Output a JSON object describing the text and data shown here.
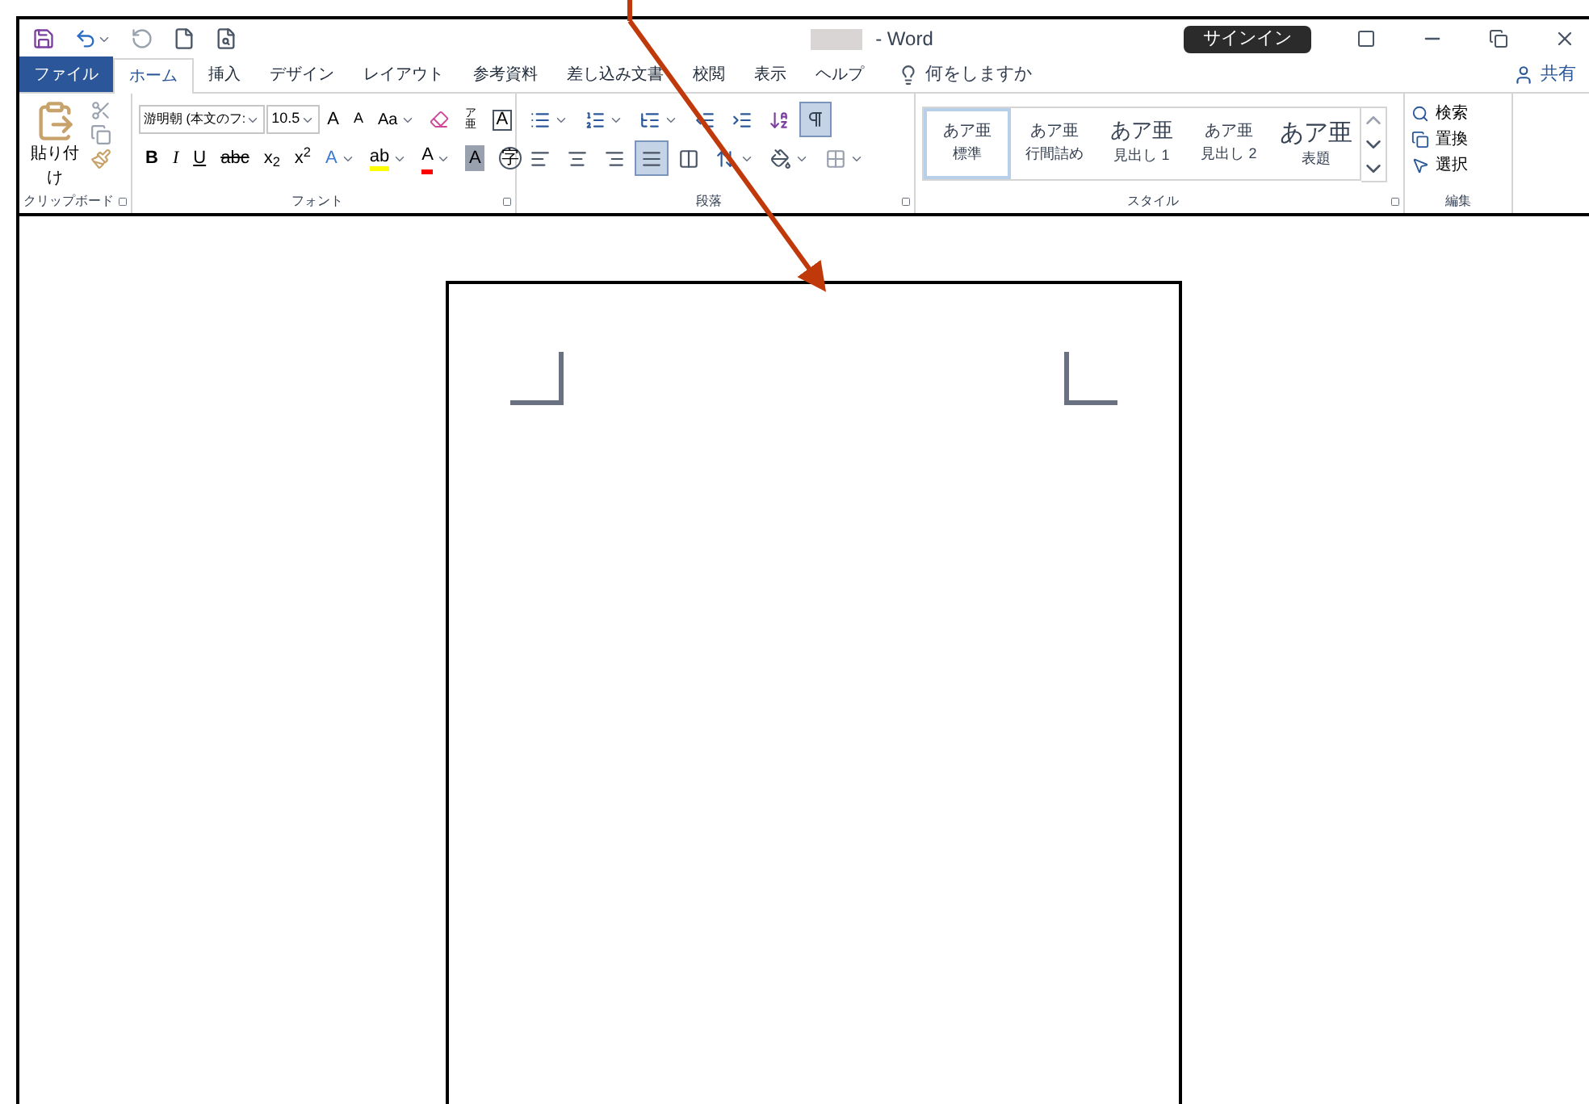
{
  "window": {
    "title": "- Word",
    "sign_in": "サインイン"
  },
  "tabs": [
    {
      "label": "ファイル",
      "kind": "file",
      "selected": false
    },
    {
      "label": "ホーム",
      "kind": "tab",
      "selected": true
    },
    {
      "label": "挿入",
      "kind": "tab",
      "selected": false
    },
    {
      "label": "デザイン",
      "kind": "tab",
      "selected": false
    },
    {
      "label": "レイアウト",
      "kind": "tab",
      "selected": false
    },
    {
      "label": "参考資料",
      "kind": "tab",
      "selected": false
    },
    {
      "label": "差し込み文書",
      "kind": "tab",
      "selected": false
    },
    {
      "label": "校閲",
      "kind": "tab",
      "selected": false
    },
    {
      "label": "表示",
      "kind": "tab",
      "selected": false
    },
    {
      "label": "ヘルプ",
      "kind": "tab",
      "selected": false
    }
  ],
  "tell_me": "何をしますか",
  "share": "共有",
  "clipboard": {
    "paste": "貼り付け",
    "label": "クリップボード"
  },
  "font": {
    "font_name": "游明朝 (本文のフ:",
    "font_size": "10.5",
    "change_case": "Aa",
    "grow": "A",
    "shrink": "A",
    "ruby": "ア亜",
    "border_char": "A",
    "format_buttons": [
      {
        "label": "B",
        "kind": "bold"
      },
      {
        "label": "I",
        "kind": "italic"
      },
      {
        "label": "U",
        "kind": "underline"
      },
      {
        "label": "abc",
        "kind": "strike"
      },
      {
        "label": "x$_{2}$",
        "kind": "plain"
      },
      {
        "label": "x$^{2}$",
        "kind": "plain"
      }
    ],
    "effect_buttons": [
      {
        "label": "A",
        "kind": "effect"
      },
      {
        "label": "ab",
        "kind": "highlight"
      },
      {
        "label": "A",
        "kind": "color"
      },
      {
        "label": "A",
        "kind": "shade"
      },
      {
        "label": "字",
        "kind": "enclose"
      }
    ],
    "label": "フォント"
  },
  "paragraph": {
    "show_marks": {
      "selected": true
    },
    "alignment": [
      {
        "kind": "left",
        "selected": false
      },
      {
        "kind": "center",
        "selected": false
      },
      {
        "kind": "right",
        "selected": false
      },
      {
        "kind": "justify",
        "selected": true
      },
      {
        "kind": "distribute",
        "selected": false
      }
    ],
    "label": "段落"
  },
  "styles": {
    "items": [
      {
        "sample": "あア亜",
        "name": "標準",
        "selected": true,
        "kind": "normal"
      },
      {
        "sample": "あア亜",
        "name": "行間詰め",
        "selected": false,
        "kind": "normal"
      },
      {
        "sample": "あア亜",
        "name": "見出し 1",
        "selected": false,
        "kind": "heading"
      },
      {
        "sample": "あア亜",
        "name": "見出し 2",
        "selected": false,
        "kind": "normal"
      },
      {
        "sample": "あア亜",
        "name": "表題",
        "selected": false,
        "kind": "title"
      }
    ],
    "label": "スタイル"
  },
  "editing": {
    "items": [
      "検索",
      "置換",
      "選択"
    ],
    "label": "編集"
  }
}
